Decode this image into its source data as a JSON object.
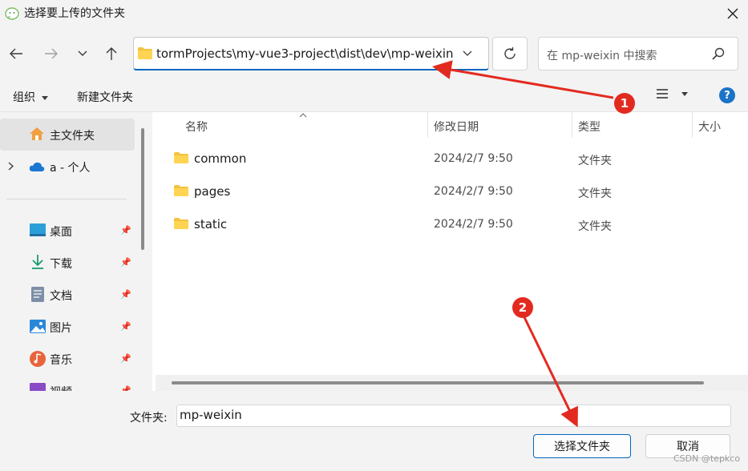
{
  "window": {
    "title": "选择要上传的文件夹"
  },
  "address_bar": {
    "path": "tormProjects\\my-vue3-project\\dist\\dev\\mp-weixin"
  },
  "search": {
    "placeholder": "在 mp-weixin 中搜索"
  },
  "toolbar": {
    "organize_label": "组织",
    "new_folder_label": "新建文件夹"
  },
  "sidebar": {
    "items": [
      {
        "label": "主文件夹",
        "icon": "home-icon"
      },
      {
        "label": "a - 个人",
        "icon": "onedrive-icon"
      },
      {
        "label": "桌面",
        "icon": "desktop-icon"
      },
      {
        "label": "下载",
        "icon": "download-icon"
      },
      {
        "label": "文档",
        "icon": "document-icon"
      },
      {
        "label": "图片",
        "icon": "pictures-icon"
      },
      {
        "label": "音乐",
        "icon": "music-icon"
      },
      {
        "label": "视频",
        "icon": "videos-icon"
      }
    ]
  },
  "columns": {
    "name": "名称",
    "modified": "修改日期",
    "type": "类型",
    "size": "大小"
  },
  "files": [
    {
      "name": "common",
      "modified": "2024/2/7 9:50",
      "type": "文件夹"
    },
    {
      "name": "pages",
      "modified": "2024/2/7 9:50",
      "type": "文件夹"
    },
    {
      "name": "static",
      "modified": "2024/2/7 9:50",
      "type": "文件夹"
    }
  ],
  "footer": {
    "folder_label": "文件夹:",
    "folder_value": "mp-weixin",
    "select_button": "选择文件夹",
    "cancel_button": "取消"
  },
  "annotations": {
    "badge_1": "1",
    "badge_2": "2",
    "color": "#e32a20"
  },
  "watermark": "CSDN @tepkco"
}
